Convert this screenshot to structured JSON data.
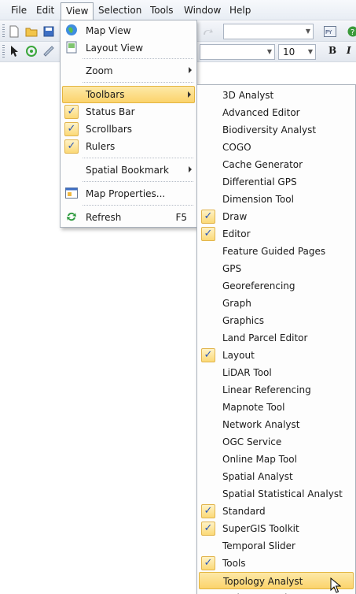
{
  "menubar": {
    "items": [
      "File",
      "Edit",
      "View",
      "Selection",
      "Tools",
      "Window",
      "Help"
    ],
    "active": "View"
  },
  "toolbar": {
    "font_size": "10",
    "bold_label": "B",
    "italic_label": "I"
  },
  "view_menu": {
    "map_view": "Map View",
    "layout_view": "Layout View",
    "zoom": "Zoom",
    "toolbars": "Toolbars",
    "status_bar": "Status Bar",
    "scrollbars": "Scrollbars",
    "rulers": "Rulers",
    "spatial_bookmark": "Spatial Bookmark",
    "map_properties": "Map Properties...",
    "refresh": "Refresh",
    "refresh_shortcut": "F5"
  },
  "toolbars_menu": {
    "items": [
      {
        "label": "3D Analyst",
        "checked": false
      },
      {
        "label": "Advanced Editor",
        "checked": false
      },
      {
        "label": "Biodiversity Analyst",
        "checked": false
      },
      {
        "label": "COGO",
        "checked": false
      },
      {
        "label": "Cache Generator",
        "checked": false
      },
      {
        "label": "Differential GPS",
        "checked": false
      },
      {
        "label": "Dimension Tool",
        "checked": false
      },
      {
        "label": "Draw",
        "checked": true
      },
      {
        "label": "Editor",
        "checked": true
      },
      {
        "label": "Feature Guided Pages",
        "checked": false
      },
      {
        "label": "GPS",
        "checked": false
      },
      {
        "label": "Georeferencing",
        "checked": false
      },
      {
        "label": "Graph",
        "checked": false
      },
      {
        "label": "Graphics",
        "checked": false
      },
      {
        "label": "Land Parcel Editor",
        "checked": false
      },
      {
        "label": "Layout",
        "checked": true
      },
      {
        "label": "LiDAR Tool",
        "checked": false
      },
      {
        "label": "Linear Referencing",
        "checked": false
      },
      {
        "label": "Mapnote Tool",
        "checked": false
      },
      {
        "label": "Network Analyst",
        "checked": false
      },
      {
        "label": "OGC Service",
        "checked": false
      },
      {
        "label": "Online Map Tool",
        "checked": false
      },
      {
        "label": "Spatial Analyst",
        "checked": false
      },
      {
        "label": "Spatial Statistical Analyst",
        "checked": false
      },
      {
        "label": "Standard",
        "checked": true
      },
      {
        "label": "SuperGIS Toolkit",
        "checked": true
      },
      {
        "label": "Temporal Slider",
        "checked": false
      },
      {
        "label": "Tools",
        "checked": true
      },
      {
        "label": "Topology Analyst",
        "checked": false,
        "highlighted": true
      },
      {
        "label": "Web Map Tool",
        "checked": false
      }
    ]
  },
  "colors": {
    "highlight": "#fbd36b",
    "check": "#2a56b8",
    "menubar": "#e8edf4"
  }
}
